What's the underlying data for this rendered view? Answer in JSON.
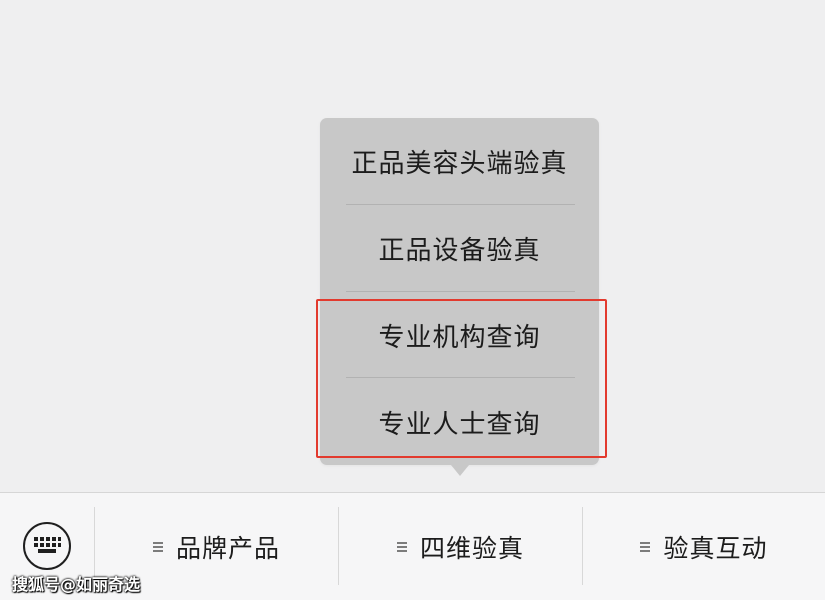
{
  "popup_menu": {
    "items": [
      {
        "label": "正品美容头端验真"
      },
      {
        "label": "正品设备验真"
      },
      {
        "label": "专业机构查询"
      },
      {
        "label": "专业人士查询"
      }
    ]
  },
  "menu_bar": {
    "keyboard_icon": "keyboard-icon",
    "tabs": [
      {
        "label": "品牌产品",
        "icon": "menu-lines-icon"
      },
      {
        "label": "四维验真",
        "icon": "menu-lines-icon"
      },
      {
        "label": "验真互动",
        "icon": "menu-lines-icon"
      }
    ]
  },
  "watermark": {
    "text": "搜狐号@如丽奇选"
  },
  "colors": {
    "background": "#efeff0",
    "popup": "#c8c8c8",
    "highlight": "#e23a2e",
    "menubar": "#f6f6f7"
  }
}
